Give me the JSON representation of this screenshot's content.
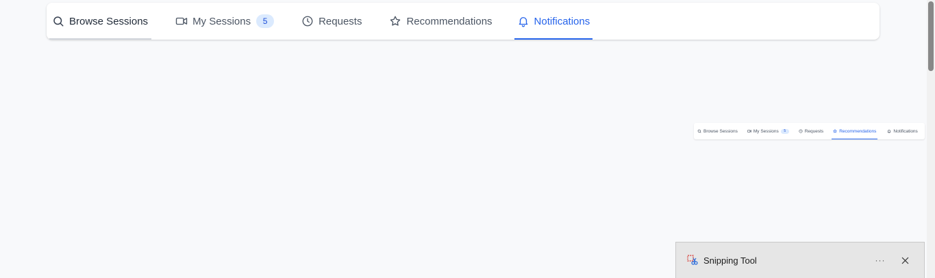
{
  "nav": {
    "tabs": [
      {
        "label": "Browse Sessions",
        "icon": "search-icon"
      },
      {
        "label": "My Sessions",
        "icon": "video-icon",
        "badge": "5"
      },
      {
        "label": "Requests",
        "icon": "clock-icon"
      },
      {
        "label": "Recommendations",
        "icon": "star-icon"
      },
      {
        "label": "Notifications",
        "icon": "bell-icon"
      }
    ],
    "active_tab": "Notifications"
  },
  "thumbnail": {
    "tabs": [
      {
        "label": "Browse Sessions",
        "icon": "search-icon"
      },
      {
        "label": "My Sessions",
        "icon": "video-icon",
        "badge": "5"
      },
      {
        "label": "Requests",
        "icon": "clock-icon"
      },
      {
        "label": "Recommendations",
        "icon": "star-icon"
      },
      {
        "label": "Notifications",
        "icon": "bell-icon"
      }
    ],
    "active_tab": "Recommendations"
  },
  "toast": {
    "app_name": "Snipping Tool",
    "more_label": "···"
  },
  "colors": {
    "accent": "#2563eb",
    "badge_bg": "#dbeafe",
    "background": "#f8f9fb"
  }
}
